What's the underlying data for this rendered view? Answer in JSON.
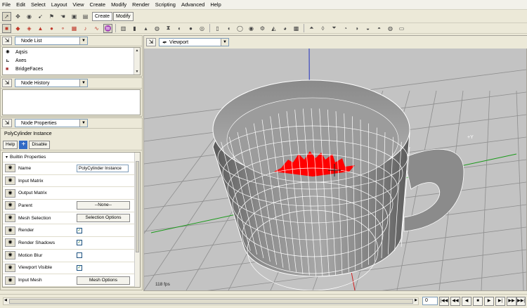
{
  "menu": [
    "File",
    "Edit",
    "Select",
    "Layout",
    "View",
    "Create",
    "Modify",
    "Render",
    "Scripting",
    "Advanced",
    "Help"
  ],
  "toolbar_tabs": {
    "create": "Create",
    "modify": "Modify"
  },
  "node_list": {
    "title": "Node List",
    "items": [
      {
        "icon": "aqsis-icon",
        "label": "Aqsis"
      },
      {
        "icon": "axes-icon",
        "label": "Axes"
      },
      {
        "icon": "bridge-faces-icon",
        "label": "BridgeFaces"
      }
    ]
  },
  "node_history": {
    "title": "Node History"
  },
  "node_properties": {
    "title": "Node Properties",
    "instance_name": "PolyCylinder Instance",
    "help_label": "Help",
    "disable_label": "Disable",
    "section_title": "Builtin Properties",
    "rows": [
      {
        "label": "Name",
        "kind": "field",
        "value": "PolyCylinder Instance"
      },
      {
        "label": "Input Matrix",
        "kind": "none",
        "value": ""
      },
      {
        "label": "Output Matrix",
        "kind": "none",
        "value": ""
      },
      {
        "label": "Parent",
        "kind": "button",
        "value": "--None--"
      },
      {
        "label": "Mesh Selection",
        "kind": "button",
        "value": "Selection Options"
      },
      {
        "label": "Render",
        "kind": "check",
        "value": "✓"
      },
      {
        "label": "Render Shadows",
        "kind": "check",
        "value": "✓"
      },
      {
        "label": "Motion Blur",
        "kind": "check",
        "value": ""
      },
      {
        "label": "Viewport Visible",
        "kind": "check",
        "value": "✓"
      },
      {
        "label": "Input Mesh",
        "kind": "button",
        "value": "Mesh Options"
      }
    ]
  },
  "viewport": {
    "title": "Viewport",
    "fps": "118 fps",
    "axis_label": "+Y"
  },
  "timeline": {
    "frame": "0"
  },
  "colors": {
    "accent": "#316ac5",
    "selection_red": "#ff0000",
    "mesh_gray": "#8a8a8a"
  }
}
